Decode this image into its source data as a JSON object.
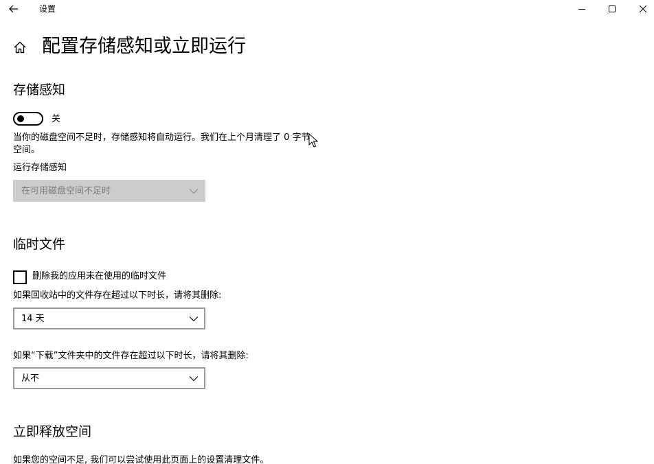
{
  "window": {
    "title": "设置"
  },
  "header": {
    "title": "配置存储感知或立即运行"
  },
  "storage_sense": {
    "heading": "存储感知",
    "toggle_state_label": "关",
    "toggle_on": false,
    "description": "当你的磁盘空间不足时，存储感知将自动运行。我们在上个月清理了 0 字节 空间。",
    "run_label": "运行存储感知",
    "run_dropdown_value": "在可用磁盘空间不足时"
  },
  "temp_files": {
    "heading": "临时文件",
    "delete_checkbox_label": "删除我的应用未在使用的临时文件",
    "delete_checkbox_checked": false,
    "recycle_label": "如果回收站中的文件存在超过以下时长，请将其删除:",
    "recycle_value": "14 天",
    "downloads_label": "如果“下载”文件夹中的文件存在超过以下时长，请将其删除:",
    "downloads_value": "从不"
  },
  "free_space": {
    "heading": "立即释放空间",
    "description": "如果您的空间不足, 我们可以尝试使用此页面上的设置清理文件。"
  },
  "icons": {
    "back": "back-arrow-icon",
    "minimize": "minimize-icon",
    "maximize": "maximize-icon",
    "close": "close-icon",
    "home": "home-icon",
    "chevron": "chevron-down-icon",
    "cursor": "mouse-cursor-icon"
  },
  "colors": {
    "disabled_dropdown_bg": "#cccccc",
    "dropdown_border": "#999999",
    "text": "#000000"
  }
}
